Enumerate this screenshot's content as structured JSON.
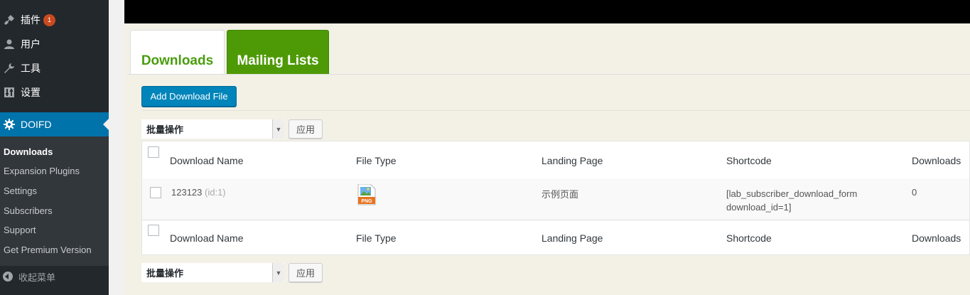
{
  "sidebar": {
    "items": [
      {
        "label": "插件",
        "badge": "1",
        "icon": "plugin-icon"
      },
      {
        "label": "用户",
        "icon": "user-icon"
      },
      {
        "label": "工具",
        "icon": "wrench-icon"
      },
      {
        "label": "设置",
        "icon": "settings-icon"
      }
    ],
    "active": {
      "label": "DOIFD",
      "icon": "gear-icon"
    },
    "submenu": [
      "Downloads",
      "Expansion Plugins",
      "Settings",
      "Subscribers",
      "Support",
      "Get Premium Version"
    ],
    "collapse_label": "收起菜单"
  },
  "tabs": [
    {
      "label": "Downloads",
      "active": true
    },
    {
      "label": "Mailing Lists",
      "active": false
    }
  ],
  "add_button_label": "Add Download File",
  "bulk_actions": {
    "selected": "批量操作",
    "apply_label": "应用"
  },
  "table": {
    "columns": [
      "Download Name",
      "File Type",
      "Landing Page",
      "Shortcode",
      "Downloads"
    ],
    "rows": [
      {
        "name": "123123",
        "id": "(id:1)",
        "file_type_icon": "png-file-icon",
        "file_type_label": "PNG",
        "landing_page": "示例页面",
        "shortcode_line1": "[lab_subscriber_download_form",
        "shortcode_line2": "download_id=1]",
        "downloads": "0"
      }
    ]
  },
  "colors": {
    "accent": "#4e9a06",
    "admin_blue": "#0073aa",
    "button_blue": "#0085ba"
  }
}
